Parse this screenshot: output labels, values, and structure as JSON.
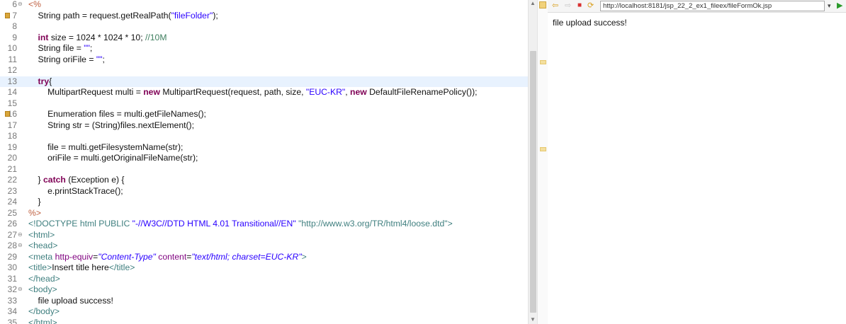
{
  "editor": {
    "current_line": "13",
    "lines": [
      {
        "n": "6",
        "fold": "⊖",
        "mark": false,
        "tokens": [
          {
            "c": "jsp",
            "t": "<%"
          }
        ]
      },
      {
        "n": "7",
        "fold": "",
        "mark": true,
        "tokens": [
          {
            "c": "",
            "t": "    String path = request.getRealPath("
          },
          {
            "c": "str",
            "t": "\"fileFolder\""
          },
          {
            "c": "",
            "t": ");"
          }
        ]
      },
      {
        "n": "8",
        "fold": "",
        "mark": false,
        "tokens": []
      },
      {
        "n": "9",
        "fold": "",
        "mark": false,
        "tokens": [
          {
            "c": "kw",
            "t": "    int"
          },
          {
            "c": "",
            "t": " size = 1024 * 1024 * 10; "
          },
          {
            "c": "cmt",
            "t": "//10M"
          }
        ]
      },
      {
        "n": "10",
        "fold": "",
        "mark": false,
        "tokens": [
          {
            "c": "",
            "t": "    String file = "
          },
          {
            "c": "str",
            "t": "\"\""
          },
          {
            "c": "",
            "t": ";"
          }
        ]
      },
      {
        "n": "11",
        "fold": "",
        "mark": false,
        "tokens": [
          {
            "c": "",
            "t": "    String oriFile = "
          },
          {
            "c": "str",
            "t": "\"\""
          },
          {
            "c": "",
            "t": ";"
          }
        ]
      },
      {
        "n": "12",
        "fold": "",
        "mark": false,
        "tokens": []
      },
      {
        "n": "13",
        "fold": "",
        "mark": false,
        "tokens": [
          {
            "c": "kw",
            "t": "    try"
          },
          {
            "c": "",
            "t": "{"
          }
        ]
      },
      {
        "n": "14",
        "fold": "",
        "mark": false,
        "tokens": [
          {
            "c": "",
            "t": "        MultipartRequest multi = "
          },
          {
            "c": "kw",
            "t": "new"
          },
          {
            "c": "",
            "t": " MultipartRequest(request, path, size, "
          },
          {
            "c": "str",
            "t": "\"EUC-KR\""
          },
          {
            "c": "",
            "t": ", "
          },
          {
            "c": "kw",
            "t": "new"
          },
          {
            "c": "",
            "t": " DefaultFileRenamePolicy());"
          }
        ]
      },
      {
        "n": "15",
        "fold": "",
        "mark": false,
        "tokens": []
      },
      {
        "n": "16",
        "fold": "",
        "mark": true,
        "tokens": [
          {
            "c": "",
            "t": "        Enumeration files = multi.getFileNames();"
          }
        ]
      },
      {
        "n": "17",
        "fold": "",
        "mark": false,
        "tokens": [
          {
            "c": "",
            "t": "        String str = (String)files.nextElement();"
          }
        ]
      },
      {
        "n": "18",
        "fold": "",
        "mark": false,
        "tokens": []
      },
      {
        "n": "19",
        "fold": "",
        "mark": false,
        "tokens": [
          {
            "c": "",
            "t": "        file = multi.getFilesystemName(str);"
          }
        ]
      },
      {
        "n": "20",
        "fold": "",
        "mark": false,
        "tokens": [
          {
            "c": "",
            "t": "        oriFile = multi.getOriginalFileName(str);"
          }
        ]
      },
      {
        "n": "21",
        "fold": "",
        "mark": false,
        "tokens": []
      },
      {
        "n": "22",
        "fold": "",
        "mark": false,
        "tokens": [
          {
            "c": "",
            "t": "    } "
          },
          {
            "c": "kw",
            "t": "catch"
          },
          {
            "c": "",
            "t": " (Exception e) {"
          }
        ]
      },
      {
        "n": "23",
        "fold": "",
        "mark": false,
        "tokens": [
          {
            "c": "",
            "t": "        e.printStackTrace();"
          }
        ]
      },
      {
        "n": "24",
        "fold": "",
        "mark": false,
        "tokens": [
          {
            "c": "",
            "t": "    }"
          }
        ]
      },
      {
        "n": "25",
        "fold": "",
        "mark": false,
        "tokens": [
          {
            "c": "jsp",
            "t": "%>"
          }
        ]
      },
      {
        "n": "26",
        "fold": "",
        "mark": false,
        "tokens": [
          {
            "c": "tag",
            "t": "<!DOCTYPE "
          },
          {
            "c": "tagn",
            "t": "html"
          },
          {
            "c": "pub",
            "t": " PUBLIC "
          },
          {
            "c": "str",
            "t": "\"-//W3C//DTD HTML 4.01 Transitional//EN\""
          },
          {
            "c": "",
            "t": " "
          },
          {
            "c": "dtds",
            "t": "\"http://www.w3.org/TR/html4/loose.dtd\""
          },
          {
            "c": "tag",
            "t": ">"
          }
        ]
      },
      {
        "n": "27",
        "fold": "⊖",
        "mark": false,
        "tokens": [
          {
            "c": "tag",
            "t": "<html>"
          }
        ]
      },
      {
        "n": "28",
        "fold": "⊖",
        "mark": false,
        "tokens": [
          {
            "c": "tag",
            "t": "<head>"
          }
        ]
      },
      {
        "n": "29",
        "fold": "",
        "mark": false,
        "tokens": [
          {
            "c": "tag",
            "t": "<meta"
          },
          {
            "c": "attr",
            "t": " http-equiv"
          },
          {
            "c": "",
            "t": "="
          },
          {
            "c": "attrv",
            "t": "\"Content-Type\""
          },
          {
            "c": "attr",
            "t": " content"
          },
          {
            "c": "",
            "t": "="
          },
          {
            "c": "attrv",
            "t": "\"text/html; charset=EUC-KR\""
          },
          {
            "c": "tag",
            "t": ">"
          }
        ]
      },
      {
        "n": "30",
        "fold": "",
        "mark": false,
        "tokens": [
          {
            "c": "tag",
            "t": "<title>"
          },
          {
            "c": "",
            "t": "Insert title here"
          },
          {
            "c": "tag",
            "t": "</title>"
          }
        ]
      },
      {
        "n": "31",
        "fold": "",
        "mark": false,
        "tokens": [
          {
            "c": "tag",
            "t": "</head>"
          }
        ]
      },
      {
        "n": "32",
        "fold": "⊖",
        "mark": false,
        "tokens": [
          {
            "c": "tag",
            "t": "<body>"
          }
        ]
      },
      {
        "n": "33",
        "fold": "",
        "mark": false,
        "tokens": [
          {
            "c": "",
            "t": "    file upload success!"
          }
        ]
      },
      {
        "n": "34",
        "fold": "",
        "mark": false,
        "tokens": [
          {
            "c": "tag",
            "t": "</body>"
          }
        ]
      },
      {
        "n": "35",
        "fold": "",
        "mark": false,
        "tokens": [
          {
            "c": "tag",
            "t": "</html>"
          }
        ]
      }
    ]
  },
  "browser": {
    "url": "http://localhost:8181/jsp_22_2_ex1_fileex/fileFormOk.jsp",
    "content": "file upload success!",
    "icons": [
      "back-arrow-icon",
      "forward-arrow-icon",
      "stop-icon",
      "refresh-icon",
      "dropdown-icon",
      "go-icon"
    ]
  },
  "colors": {
    "keyword": "#7f0055",
    "string": "#2a00ff",
    "comment": "#3f7f5f",
    "tag": "#3f7f7f",
    "attribute": "#7f007f",
    "jsp_delimiter": "#bf5f3f",
    "current_line_bg": "#e8f2fe"
  }
}
